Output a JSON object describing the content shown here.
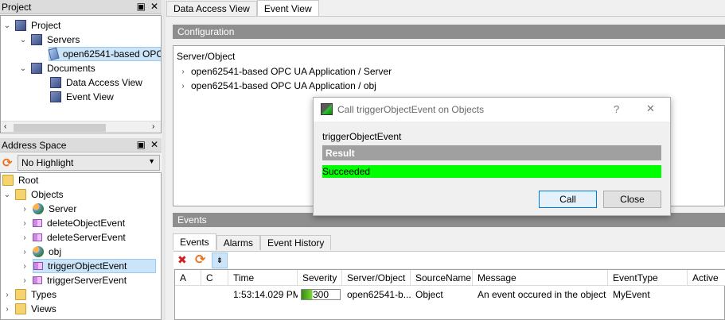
{
  "project_panel": {
    "title": "Project",
    "float_icon": "restore-icon",
    "close_icon": "close-icon",
    "items": [
      {
        "label": "Project",
        "icon": "document-icon",
        "expanded": true
      },
      {
        "label": "Servers",
        "icon": "document-icon",
        "expanded": true
      },
      {
        "label": "open62541-based OPC",
        "icon": "server-connection-icon"
      },
      {
        "label": "Documents",
        "icon": "document-icon",
        "expanded": true
      },
      {
        "label": "Data Access View",
        "icon": "document-icon"
      },
      {
        "label": "Event View",
        "icon": "document-icon"
      }
    ]
  },
  "address_panel": {
    "title": "Address Space",
    "highlight_select": "No Highlight",
    "items": [
      {
        "label": "Root",
        "icon": "folder-icon"
      },
      {
        "label": "Objects",
        "icon": "folder-icon"
      },
      {
        "label": "Server",
        "icon": "server-object-icon"
      },
      {
        "label": "deleteObjectEvent",
        "icon": "method-icon"
      },
      {
        "label": "deleteServerEvent",
        "icon": "method-icon"
      },
      {
        "label": "obj",
        "icon": "server-object-icon"
      },
      {
        "label": "triggerObjectEvent",
        "icon": "method-icon"
      },
      {
        "label": "triggerServerEvent",
        "icon": "method-icon"
      },
      {
        "label": "Types",
        "icon": "folder-icon"
      },
      {
        "label": "Views",
        "icon": "folder-icon"
      }
    ]
  },
  "main_tabs": [
    "Data Access View",
    "Event View"
  ],
  "configuration": {
    "header": "Configuration",
    "column": "Server/Object",
    "items": [
      "open62541-based OPC UA Application / Server",
      "open62541-based OPC UA Application / obj"
    ]
  },
  "events": {
    "header": "Events",
    "tabs": [
      "Events",
      "Alarms",
      "Event History"
    ],
    "columns": [
      "A",
      "C",
      "Time",
      "Severity",
      "Server/Object",
      "SourceName",
      "Message",
      "EventType",
      "Active"
    ],
    "rows": [
      {
        "a": "",
        "c": "",
        "time": "1:53:14.029 PM",
        "severity": "300",
        "server": "open62541-b...",
        "source": "Object",
        "message": "An event occured in the object",
        "type": "MyEvent",
        "active": ""
      }
    ]
  },
  "dialog": {
    "title": "Call triggerObjectEvent on Objects",
    "help": "?",
    "close": "✕",
    "method": "triggerObjectEvent",
    "result_label": "Result",
    "status": "Succeeded",
    "call_button": "Call",
    "close_button": "Close"
  },
  "colors": {
    "success": "#00ff00",
    "header_gray": "#8e8e8e"
  }
}
